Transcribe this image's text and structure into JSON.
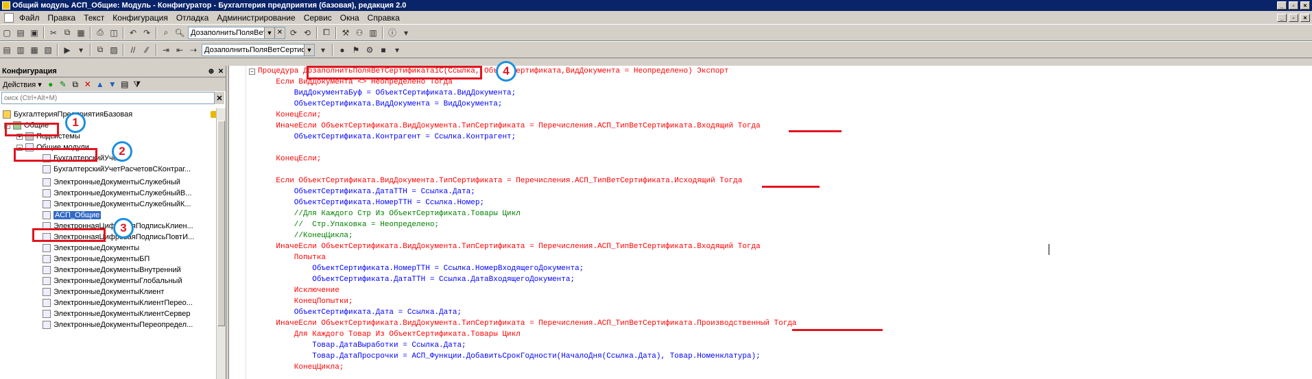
{
  "window": {
    "title": "Общий модуль АСП_Общие: Модуль - Конфигуратор - Бухгалтерия предприятия (базовая), редакция 2.0"
  },
  "menu": {
    "items": [
      "Файл",
      "Правка",
      "Текст",
      "Конфигурация",
      "Отладка",
      "Администрирование",
      "Сервис",
      "Окна",
      "Справка"
    ]
  },
  "toolbar1": {
    "combo_value": "ДозаполнитьПоляВет|"
  },
  "toolbar2": {
    "combo_value": "ДозаполнитьПоляВетСертифи"
  },
  "left_panel": {
    "title": "Конфигурация",
    "actions_label": "Действия",
    "search_placeholder": "оиск (Ctrl+Alt+M)",
    "tree": [
      "БухгалтерияПредприятияБазовая",
      "Общие",
      "Подсистемы",
      "Общие модули",
      "БухгалтерскийУчет",
      "БухгалтерскийУчетРасчетовСКонтраг...",
      "ЭлектронныеДокументыСлужебный",
      "ЭлектронныеДокументыСлужебныйВ...",
      "ЭлектронныеДокументыСлужебныйК...",
      "АСП_Общие",
      "ЭлектроннаяЦифроваяПодписьКлиен...",
      "ЭлектроннаяЦифроваяПодписьПовтИ...",
      "ЭлектронныеДокументы",
      "ЭлектронныеДокументыБП",
      "ЭлектронныеДокументыВнутренний",
      "ЭлектронныеДокументыГлобальный",
      "ЭлектронныеДокументыКлиент",
      "ЭлектронныеДокументыКлиентПерео...",
      "ЭлектронныеДокументыКлиентСервер",
      "ЭлектронныеДокументыПереопредел..."
    ]
  },
  "code": {
    "lines": [
      "Процедура ДозаполнитьПоляВетСертификата1С(Ссылка, ОбъектСертификата,ВидДокумента = Неопределено) Экспорт",
      "    Если ВидДокумента <> Неопределено Тогда",
      "        ВидДокументаБуф = ОбъектСертификата.ВидДокумента;",
      "        ОбъектСертификата.ВидДокумента = ВидДокумента;",
      "    КонецЕсли;",
      "    ИначеЕсли ОбъектСертификата.ВидДокумента.ТипСертификата = Перечисления.АСП_ТипВетСертификата.Входящий Тогда",
      "        ОбъектСертификата.Контрагент = Ссылка.Контрагент;",
      "",
      "    КонецЕсли;",
      "",
      "    Если ОбъектСертификата.ВидДокумента.ТипСертификата = Перечисления.АСП_ТипВетСертификата.Исходящий Тогда",
      "        ОбъектСертификата.ДатаТТН = Ссылка.Дата;",
      "        ОбъектСертификата.НомерТТН = Ссылка.Номер;",
      "        //Для Каждого Стр Из ОбъектСертификата.Товары Цикл",
      "        //  Стр.Упаковка = Неопределено;",
      "        //КонецЦикла;",
      "    ИначеЕсли ОбъектСертификата.ВидДокумента.ТипСертификата = Перечисления.АСП_ТипВетСертификата.Входящий Тогда",
      "        Попытка",
      "            ОбъектСертификата.НомерТТН = Ссылка.НомерВходящегоДокумента;",
      "            ОбъектСертификата.ДатаТТН = Ссылка.ДатаВходящегоДокумента;",
      "        Исключение",
      "        КонецПопытки;",
      "        ОбъектСертификата.Дата = Ссылка.Дата;",
      "    ИначеЕсли ОбъектСертификата.ВидДокумента.ТипСертификата = Перечисления.АСП_ТипВетСертификата.Производственный Тогда",
      "        Для Каждого Товар Из ОбъектСертификата.Товары Цикл",
      "            Товар.ДатаВыработки = Ссылка.Дата;",
      "            Товар.ДатаПросрочки = АСП_Функции.ДобавитьСрокГодности(НачалоДня(Ссылка.Дата), Товар.Номенклатура);",
      "        КонецЦикла;"
    ]
  },
  "annotations": [
    "1",
    "2",
    "3",
    "4"
  ]
}
